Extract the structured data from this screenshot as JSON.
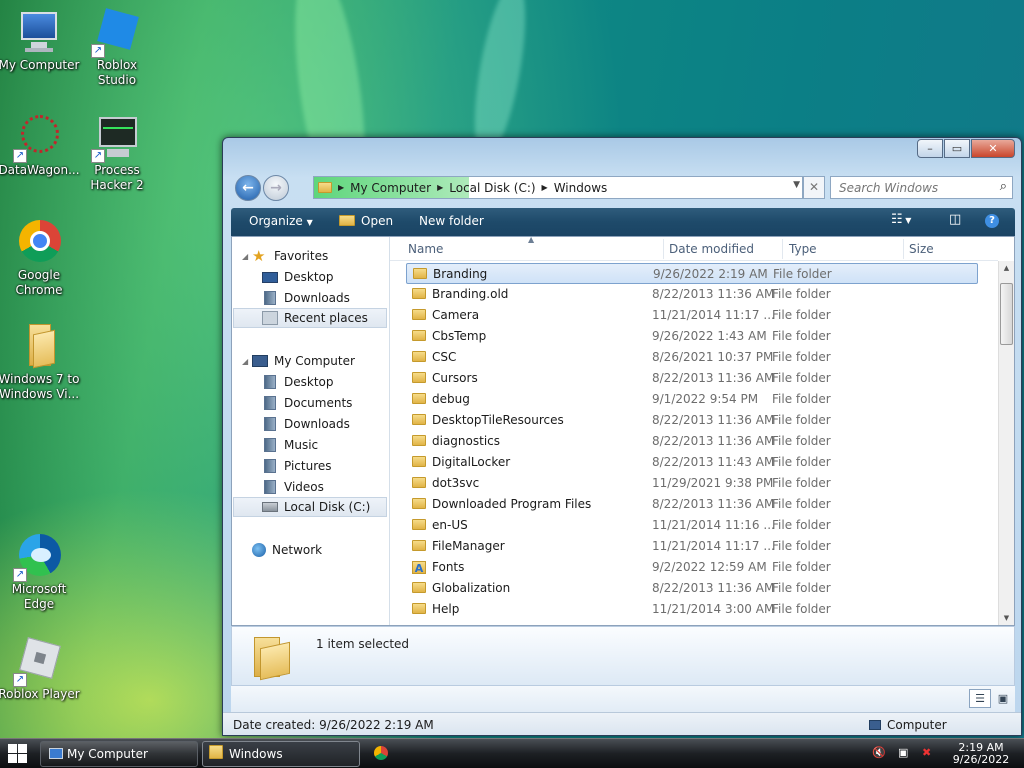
{
  "desktop": {
    "icons": [
      {
        "label": "My Computer",
        "icon": "computer-icon"
      },
      {
        "label": "Roblox Studio",
        "icon": "roblox-studio-icon"
      },
      {
        "label": "DataWagon...",
        "icon": "datawagon-icon"
      },
      {
        "label": "Process Hacker 2",
        "icon": "process-hacker-icon"
      },
      {
        "label": "Google Chrome",
        "icon": "chrome-icon"
      },
      {
        "label": "Windows 7 to Windows Vi...",
        "icon": "folder-icon"
      },
      {
        "label": "Microsoft Edge",
        "icon": "edge-icon"
      },
      {
        "label": "Roblox Player",
        "icon": "roblox-player-icon"
      }
    ]
  },
  "window": {
    "caption_buttons": {
      "minimize": "–",
      "maximize": "▭",
      "close": "✕"
    },
    "address": {
      "segments": [
        "My Computer",
        "Local Disk (C:)",
        "Windows"
      ],
      "separator": "▶"
    },
    "search": {
      "placeholder": "Search Windows"
    },
    "toolbar": {
      "organize": "Organize",
      "open": "Open",
      "new_folder": "New folder"
    },
    "nav": {
      "favorites": "Favorites",
      "fav_desktop": "Desktop",
      "fav_downloads": "Downloads",
      "recent_places": "Recent places",
      "my_computer": "My Computer",
      "mc_desktop": "Desktop",
      "mc_documents": "Documents",
      "mc_downloads": "Downloads",
      "mc_music": "Music",
      "mc_pictures": "Pictures",
      "mc_videos": "Videos",
      "local_disk": "Local Disk (C:)",
      "network": "Network"
    },
    "columns": {
      "name": "Name",
      "date": "Date modified",
      "type": "Type",
      "size": "Size"
    },
    "files": [
      {
        "name": "Branding",
        "date": "9/26/2022 2:19 AM",
        "type": "File folder",
        "selected": true,
        "icon": "folder"
      },
      {
        "name": "Branding.old",
        "date": "8/22/2013 11:36 AM",
        "type": "File folder",
        "icon": "folder"
      },
      {
        "name": "Camera",
        "date": "11/21/2014 11:17 ...",
        "type": "File folder",
        "icon": "folder"
      },
      {
        "name": "CbsTemp",
        "date": "9/26/2022 1:43 AM",
        "type": "File folder",
        "icon": "folder"
      },
      {
        "name": "CSC",
        "date": "8/26/2021 10:37 PM",
        "type": "File folder",
        "icon": "folder"
      },
      {
        "name": "Cursors",
        "date": "8/22/2013 11:36 AM",
        "type": "File folder",
        "icon": "folder"
      },
      {
        "name": "debug",
        "date": "9/1/2022 9:54 PM",
        "type": "File folder",
        "icon": "folder"
      },
      {
        "name": "DesktopTileResources",
        "date": "8/22/2013 11:36 AM",
        "type": "File folder",
        "icon": "folder"
      },
      {
        "name": "diagnostics",
        "date": "8/22/2013 11:36 AM",
        "type": "File folder",
        "icon": "folder"
      },
      {
        "name": "DigitalLocker",
        "date": "8/22/2013 11:43 AM",
        "type": "File folder",
        "icon": "folder"
      },
      {
        "name": "dot3svc",
        "date": "11/29/2021 9:38 PM",
        "type": "File folder",
        "icon": "folder"
      },
      {
        "name": "Downloaded Program Files",
        "date": "8/22/2013 11:36 AM",
        "type": "File folder",
        "icon": "folder"
      },
      {
        "name": "en-US",
        "date": "11/21/2014 11:16 ...",
        "type": "File folder",
        "icon": "folder"
      },
      {
        "name": "FileManager",
        "date": "11/21/2014 11:17 ...",
        "type": "File folder",
        "icon": "folder"
      },
      {
        "name": "Fonts",
        "date": "9/2/2022 12:59 AM",
        "type": "File folder",
        "icon": "fonts"
      },
      {
        "name": "Globalization",
        "date": "8/22/2013 11:36 AM",
        "type": "File folder",
        "icon": "folder"
      },
      {
        "name": "Help",
        "date": "11/21/2014 3:00 AM",
        "type": "File folder",
        "icon": "folder"
      }
    ],
    "details": {
      "text": "1 item selected"
    },
    "status": {
      "date_created": "Date created: 9/26/2022 2:19 AM",
      "location": "Computer"
    }
  },
  "taskbar": {
    "items": [
      {
        "label": "My Computer",
        "icon": "computer-icon"
      },
      {
        "label": "Windows",
        "icon": "folder-icon",
        "active": true
      },
      {
        "label": "",
        "icon": "chrome-icon"
      }
    ],
    "clock": {
      "time": "2:19 AM",
      "date": "9/26/2022"
    }
  }
}
